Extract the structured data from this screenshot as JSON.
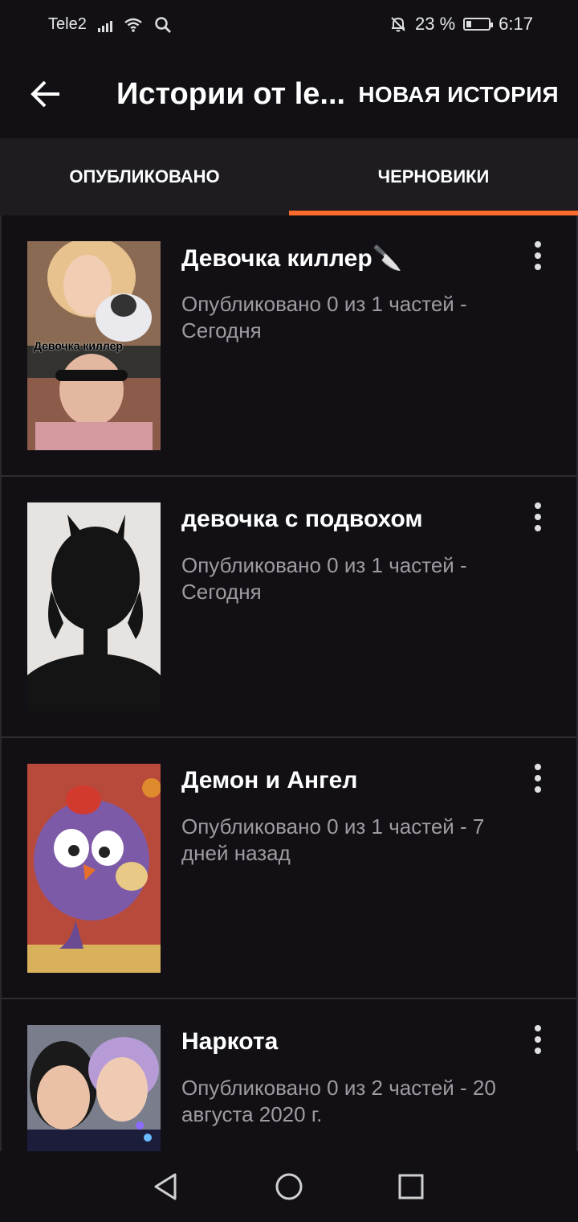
{
  "status_bar": {
    "carrier": "Tele2",
    "battery_text": "23 %",
    "battery_level": 0.23,
    "time": "6:17"
  },
  "app_bar": {
    "title": "Истории от le...",
    "new_story_label": "НОВАЯ ИСТОРИЯ"
  },
  "tabs": [
    {
      "label": "ОПУБЛИКОВАНО",
      "active": false
    },
    {
      "label": "ЧЕРНОВИКИ",
      "active": true
    }
  ],
  "accent_color": "#ff6b2c",
  "stories": [
    {
      "title": "Девочка киллер🔪",
      "meta": "Опубликовано 0 из 1 частей - Сегодня",
      "cover_caption": "Девочка киллер"
    },
    {
      "title": "девочка с подвохом",
      "meta": "Опубликовано 0 из 1 частей - Сегодня"
    },
    {
      "title": "Демон и Ангел",
      "meta": "Опубликовано 0 из 1 частей - 7 дней назад"
    },
    {
      "title": "Наркота",
      "meta": "Опубликовано 0 из 2 частей - 20 августа 2020 г."
    }
  ],
  "icons": {
    "back": "arrow-left-icon",
    "more": "more-vertical-icon",
    "nav_back": "triangle-back-icon",
    "nav_home": "circle-home-icon",
    "nav_recents": "square-recents-icon"
  }
}
